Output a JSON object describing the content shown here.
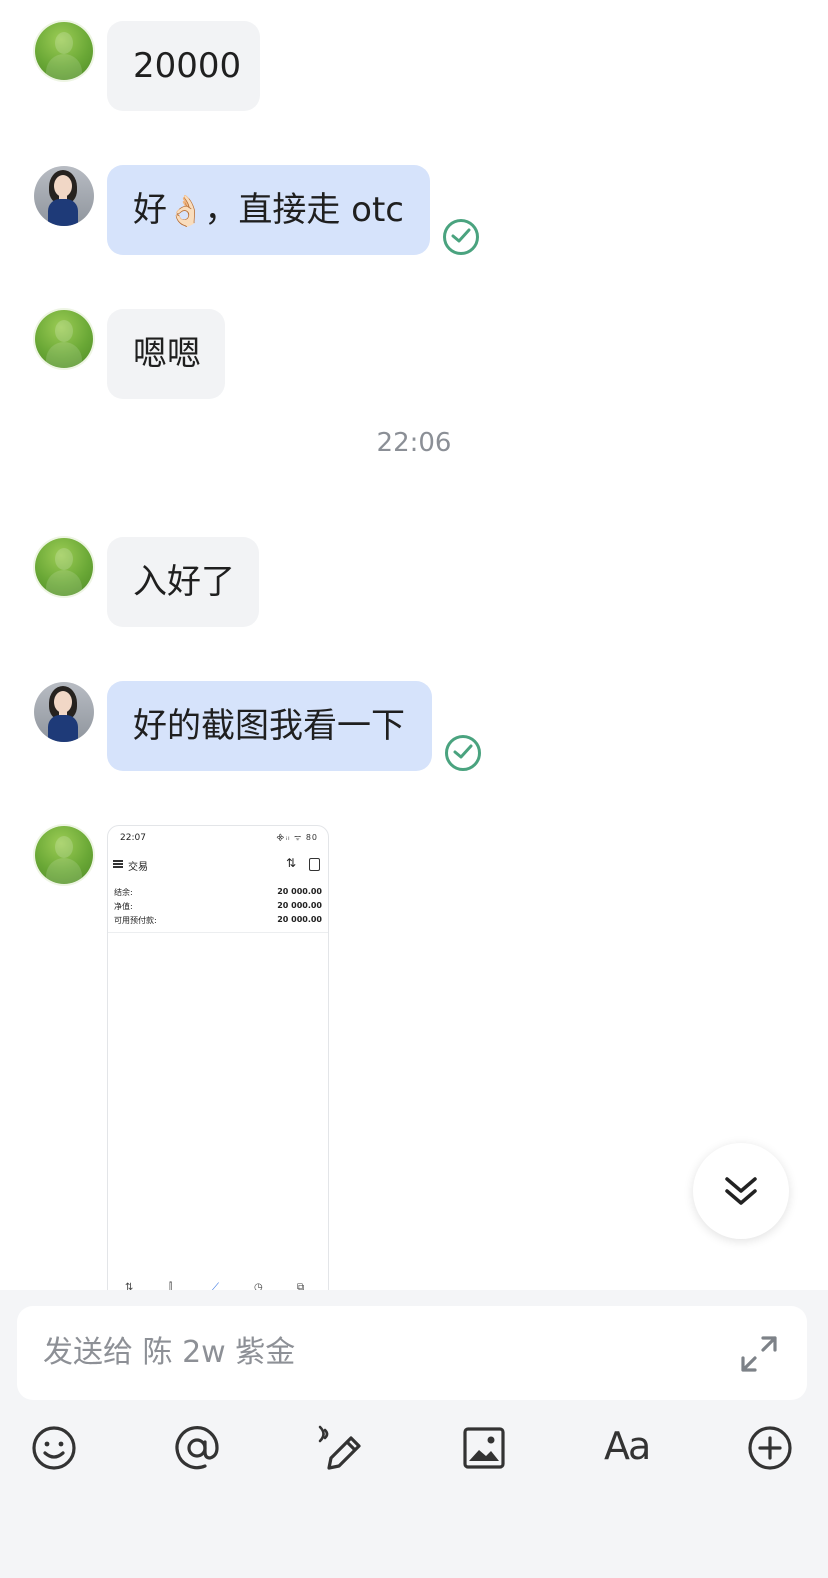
{
  "messages": [
    {
      "side": "in",
      "text": "20000"
    },
    {
      "side": "out",
      "text_before": "好",
      "emoji": "👌🏻",
      "text_after": "，直接走 otc"
    },
    {
      "side": "in",
      "text": "嗯嗯"
    },
    {
      "side": "in",
      "text": "入好了"
    },
    {
      "side": "out",
      "text": "好的截图我看一下"
    }
  ],
  "timestamp": "22:06",
  "screenshot_preview": {
    "status_time": "22:07",
    "status_right": "᯽ᵢₗ ᯤ 80",
    "title": "交易",
    "rows": [
      {
        "label": "结余:",
        "value": "20 000.00"
      },
      {
        "label": "净值:",
        "value": "20 000.00"
      },
      {
        "label": "可用预付款:",
        "value": "20 000.00"
      }
    ],
    "nav_icons": [
      "⇅",
      "⫿",
      "⟋",
      "◷",
      "⧉"
    ]
  },
  "composer": {
    "placeholder": "发送给 陈 2w 紫金"
  },
  "toolbar": {
    "font_label": "Aa",
    "icons": [
      "emoji-icon",
      "at-icon",
      "voice-pen-icon",
      "image-icon",
      "font-icon",
      "plus-icon"
    ]
  },
  "colors": {
    "incoming_bubble": "#f2f3f5",
    "outgoing_bubble": "#d6e3fb",
    "read_check": "#4aa37f"
  }
}
